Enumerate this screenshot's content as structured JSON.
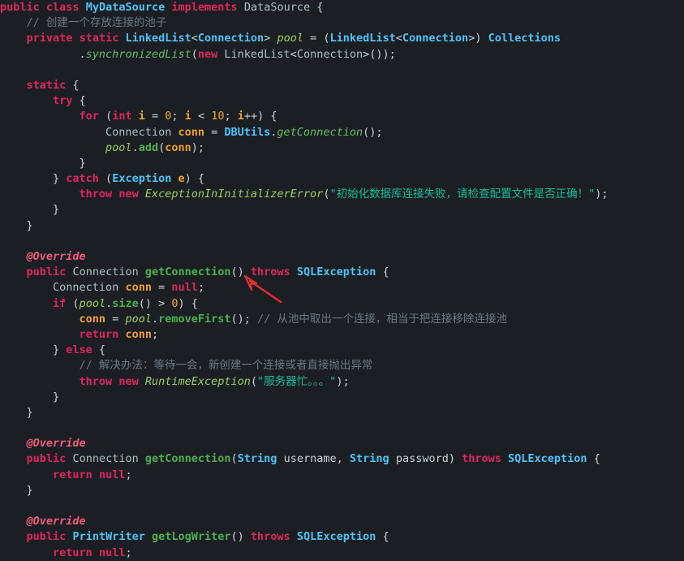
{
  "editor": {
    "language": "java",
    "background_color": "#1b1f23",
    "colors": {
      "keyword": "#e0245e",
      "class_name": "#4fc3f7",
      "method": "#4caf50",
      "string": "#1abc9c",
      "comment": "#6e7781",
      "number": "#f0a830",
      "variable": "#f0a030",
      "field": "#9ccc65",
      "annotation": "#ef5a7a",
      "punctuation": "#c9d1d9",
      "arrow_annotation": "#e03030"
    },
    "annotation": {
      "type": "red-arrow",
      "points_at": "getConnection",
      "color": "#e03030"
    }
  },
  "code": {
    "lines": [
      {
        "n": 1,
        "tokens": [
          {
            "t": "public",
            "c": "kw"
          },
          {
            "t": " ",
            "c": "punc"
          },
          {
            "t": "class",
            "c": "kw"
          },
          {
            "t": " ",
            "c": "punc"
          },
          {
            "t": "MyDataSource",
            "c": "type"
          },
          {
            "t": " ",
            "c": "punc"
          },
          {
            "t": "implements",
            "c": "kw"
          },
          {
            "t": " ",
            "c": "punc"
          },
          {
            "t": "DataSource",
            "c": "plaintype"
          },
          {
            "t": " {",
            "c": "punc"
          }
        ]
      },
      {
        "n": 2,
        "tokens": [
          {
            "t": "    ",
            "c": "punc"
          },
          {
            "t": "// 创建一个存放连接的池子",
            "c": "cmt"
          }
        ]
      },
      {
        "n": 3,
        "tokens": [
          {
            "t": "    ",
            "c": "punc"
          },
          {
            "t": "private",
            "c": "kw"
          },
          {
            "t": " ",
            "c": "punc"
          },
          {
            "t": "static",
            "c": "kw"
          },
          {
            "t": " ",
            "c": "punc"
          },
          {
            "t": "LinkedList",
            "c": "type"
          },
          {
            "t": "<",
            "c": "punc"
          },
          {
            "t": "Connection",
            "c": "type"
          },
          {
            "t": "> ",
            "c": "punc"
          },
          {
            "t": "pool",
            "c": "fld"
          },
          {
            "t": " = (",
            "c": "punc"
          },
          {
            "t": "LinkedList",
            "c": "type"
          },
          {
            "t": "<",
            "c": "punc"
          },
          {
            "t": "Connection",
            "c": "type"
          },
          {
            "t": ">) ",
            "c": "punc"
          },
          {
            "t": "Collections",
            "c": "type"
          }
        ]
      },
      {
        "n": 4,
        "tokens": [
          {
            "t": "            .",
            "c": "punc"
          },
          {
            "t": "synchronizedList",
            "c": "methi"
          },
          {
            "t": "(",
            "c": "punc"
          },
          {
            "t": "new",
            "c": "kw"
          },
          {
            "t": " ",
            "c": "punc"
          },
          {
            "t": "LinkedList",
            "c": "plaintype"
          },
          {
            "t": "<",
            "c": "punc"
          },
          {
            "t": "Connection",
            "c": "plaintype"
          },
          {
            "t": ">());",
            "c": "punc"
          }
        ]
      },
      {
        "n": 5,
        "tokens": []
      },
      {
        "n": 6,
        "tokens": [
          {
            "t": "    ",
            "c": "punc"
          },
          {
            "t": "static",
            "c": "kw"
          },
          {
            "t": " {",
            "c": "punc"
          }
        ]
      },
      {
        "n": 7,
        "tokens": [
          {
            "t": "        ",
            "c": "punc"
          },
          {
            "t": "try",
            "c": "kw"
          },
          {
            "t": " {",
            "c": "punc"
          }
        ]
      },
      {
        "n": 8,
        "tokens": [
          {
            "t": "            ",
            "c": "punc"
          },
          {
            "t": "for",
            "c": "kw"
          },
          {
            "t": " (",
            "c": "punc"
          },
          {
            "t": "int",
            "c": "kw"
          },
          {
            "t": " ",
            "c": "punc"
          },
          {
            "t": "i",
            "c": "var"
          },
          {
            "t": " = ",
            "c": "punc"
          },
          {
            "t": "0",
            "c": "num"
          },
          {
            "t": "; ",
            "c": "punc"
          },
          {
            "t": "i",
            "c": "var"
          },
          {
            "t": " < ",
            "c": "punc"
          },
          {
            "t": "10",
            "c": "num"
          },
          {
            "t": "; ",
            "c": "punc"
          },
          {
            "t": "i",
            "c": "var"
          },
          {
            "t": "++) {",
            "c": "punc"
          }
        ]
      },
      {
        "n": 9,
        "tokens": [
          {
            "t": "                ",
            "c": "punc"
          },
          {
            "t": "Connection",
            "c": "plaintype"
          },
          {
            "t": " ",
            "c": "punc"
          },
          {
            "t": "conn",
            "c": "var"
          },
          {
            "t": " = ",
            "c": "punc"
          },
          {
            "t": "DBUtils",
            "c": "type"
          },
          {
            "t": ".",
            "c": "punc"
          },
          {
            "t": "getConnection",
            "c": "methi"
          },
          {
            "t": "();",
            "c": "punc"
          }
        ]
      },
      {
        "n": 10,
        "tokens": [
          {
            "t": "                ",
            "c": "punc"
          },
          {
            "t": "pool",
            "c": "fld"
          },
          {
            "t": ".",
            "c": "punc"
          },
          {
            "t": "add",
            "c": "meth"
          },
          {
            "t": "(",
            "c": "punc"
          },
          {
            "t": "conn",
            "c": "var"
          },
          {
            "t": ");",
            "c": "punc"
          }
        ]
      },
      {
        "n": 11,
        "tokens": [
          {
            "t": "            }",
            "c": "punc"
          }
        ]
      },
      {
        "n": 12,
        "tokens": [
          {
            "t": "        } ",
            "c": "punc"
          },
          {
            "t": "catch",
            "c": "kw"
          },
          {
            "t": " (",
            "c": "punc"
          },
          {
            "t": "Exception",
            "c": "type"
          },
          {
            "t": " ",
            "c": "punc"
          },
          {
            "t": "e",
            "c": "var"
          },
          {
            "t": ") {",
            "c": "punc"
          }
        ]
      },
      {
        "n": 13,
        "tokens": [
          {
            "t": "            ",
            "c": "punc"
          },
          {
            "t": "throw",
            "c": "kw"
          },
          {
            "t": " ",
            "c": "punc"
          },
          {
            "t": "new",
            "c": "kw"
          },
          {
            "t": " ",
            "c": "punc"
          },
          {
            "t": "ExceptionInInitializerError",
            "c": "fld"
          },
          {
            "t": "(",
            "c": "punc"
          },
          {
            "t": "\"初始化数据库连接失败，请检查配置文件是否正确！\"",
            "c": "str"
          },
          {
            "t": ");",
            "c": "punc"
          }
        ]
      },
      {
        "n": 14,
        "tokens": [
          {
            "t": "        }",
            "c": "punc"
          }
        ]
      },
      {
        "n": 15,
        "tokens": [
          {
            "t": "    }",
            "c": "punc"
          }
        ]
      },
      {
        "n": 16,
        "tokens": []
      },
      {
        "n": 17,
        "tokens": [
          {
            "t": "    ",
            "c": "punc"
          },
          {
            "t": "@Override",
            "c": "ann"
          }
        ]
      },
      {
        "n": 18,
        "tokens": [
          {
            "t": "    ",
            "c": "punc"
          },
          {
            "t": "public",
            "c": "kw"
          },
          {
            "t": " ",
            "c": "punc"
          },
          {
            "t": "Connection",
            "c": "plaintype"
          },
          {
            "t": " ",
            "c": "punc"
          },
          {
            "t": "getConnection",
            "c": "meth"
          },
          {
            "t": "() ",
            "c": "punc"
          },
          {
            "t": "throws",
            "c": "kw"
          },
          {
            "t": " ",
            "c": "punc"
          },
          {
            "t": "SQLException",
            "c": "type"
          },
          {
            "t": " {",
            "c": "punc"
          }
        ]
      },
      {
        "n": 19,
        "tokens": [
          {
            "t": "        ",
            "c": "punc"
          },
          {
            "t": "Connection",
            "c": "plaintype"
          },
          {
            "t": " ",
            "c": "punc"
          },
          {
            "t": "conn",
            "c": "var"
          },
          {
            "t": " = ",
            "c": "punc"
          },
          {
            "t": "null",
            "c": "kw"
          },
          {
            "t": ";",
            "c": "punc"
          }
        ]
      },
      {
        "n": 20,
        "tokens": [
          {
            "t": "        ",
            "c": "punc"
          },
          {
            "t": "if",
            "c": "kw"
          },
          {
            "t": " (",
            "c": "punc"
          },
          {
            "t": "pool",
            "c": "fld"
          },
          {
            "t": ".",
            "c": "punc"
          },
          {
            "t": "size",
            "c": "meth"
          },
          {
            "t": "() > ",
            "c": "punc"
          },
          {
            "t": "0",
            "c": "num"
          },
          {
            "t": ") {",
            "c": "punc"
          }
        ]
      },
      {
        "n": 21,
        "tokens": [
          {
            "t": "            ",
            "c": "punc"
          },
          {
            "t": "conn",
            "c": "var"
          },
          {
            "t": " = ",
            "c": "punc"
          },
          {
            "t": "pool",
            "c": "fld"
          },
          {
            "t": ".",
            "c": "punc"
          },
          {
            "t": "removeFirst",
            "c": "meth"
          },
          {
            "t": "(); ",
            "c": "punc"
          },
          {
            "t": "// 从池中取出一个连接，相当于把连接移除连接池",
            "c": "cmt"
          }
        ]
      },
      {
        "n": 22,
        "tokens": [
          {
            "t": "            ",
            "c": "punc"
          },
          {
            "t": "return",
            "c": "kw"
          },
          {
            "t": " ",
            "c": "punc"
          },
          {
            "t": "conn",
            "c": "var"
          },
          {
            "t": ";",
            "c": "punc"
          }
        ]
      },
      {
        "n": 23,
        "tokens": [
          {
            "t": "        } ",
            "c": "punc"
          },
          {
            "t": "else",
            "c": "kw"
          },
          {
            "t": " {",
            "c": "punc"
          }
        ]
      },
      {
        "n": 24,
        "tokens": [
          {
            "t": "            ",
            "c": "punc"
          },
          {
            "t": "// 解决办法：等待一会，新创建一个连接或者直接抛出异常",
            "c": "cmt"
          }
        ]
      },
      {
        "n": 25,
        "tokens": [
          {
            "t": "            ",
            "c": "punc"
          },
          {
            "t": "throw",
            "c": "kw"
          },
          {
            "t": " ",
            "c": "punc"
          },
          {
            "t": "new",
            "c": "kw"
          },
          {
            "t": " ",
            "c": "punc"
          },
          {
            "t": "RuntimeException",
            "c": "fld"
          },
          {
            "t": "(",
            "c": "punc"
          },
          {
            "t": "\"服务器忙。。。\"",
            "c": "str"
          },
          {
            "t": ");",
            "c": "punc"
          }
        ]
      },
      {
        "n": 26,
        "tokens": [
          {
            "t": "        }",
            "c": "punc"
          }
        ]
      },
      {
        "n": 27,
        "tokens": [
          {
            "t": "    }",
            "c": "punc"
          }
        ]
      },
      {
        "n": 28,
        "tokens": []
      },
      {
        "n": 29,
        "tokens": [
          {
            "t": "    ",
            "c": "punc"
          },
          {
            "t": "@Override",
            "c": "ann"
          }
        ]
      },
      {
        "n": 30,
        "tokens": [
          {
            "t": "    ",
            "c": "punc"
          },
          {
            "t": "public",
            "c": "kw"
          },
          {
            "t": " ",
            "c": "punc"
          },
          {
            "t": "Connection",
            "c": "plaintype"
          },
          {
            "t": " ",
            "c": "punc"
          },
          {
            "t": "getConnection",
            "c": "meth"
          },
          {
            "t": "(",
            "c": "punc"
          },
          {
            "t": "String",
            "c": "type"
          },
          {
            "t": " ",
            "c": "punc"
          },
          {
            "t": "username",
            "c": "ident"
          },
          {
            "t": ", ",
            "c": "punc"
          },
          {
            "t": "String",
            "c": "type"
          },
          {
            "t": " ",
            "c": "punc"
          },
          {
            "t": "password",
            "c": "ident"
          },
          {
            "t": ") ",
            "c": "punc"
          },
          {
            "t": "throws",
            "c": "kw"
          },
          {
            "t": " ",
            "c": "punc"
          },
          {
            "t": "SQLException",
            "c": "type"
          },
          {
            "t": " {",
            "c": "punc"
          }
        ]
      },
      {
        "n": 31,
        "tokens": [
          {
            "t": "        ",
            "c": "punc"
          },
          {
            "t": "return",
            "c": "kw"
          },
          {
            "t": " ",
            "c": "punc"
          },
          {
            "t": "null",
            "c": "kw"
          },
          {
            "t": ";",
            "c": "punc"
          }
        ]
      },
      {
        "n": 32,
        "tokens": [
          {
            "t": "    }",
            "c": "punc"
          }
        ]
      },
      {
        "n": 33,
        "tokens": []
      },
      {
        "n": 34,
        "tokens": [
          {
            "t": "    ",
            "c": "punc"
          },
          {
            "t": "@Override",
            "c": "ann"
          }
        ]
      },
      {
        "n": 35,
        "tokens": [
          {
            "t": "    ",
            "c": "punc"
          },
          {
            "t": "public",
            "c": "kw"
          },
          {
            "t": " ",
            "c": "punc"
          },
          {
            "t": "PrintWriter",
            "c": "type"
          },
          {
            "t": " ",
            "c": "punc"
          },
          {
            "t": "getLogWriter",
            "c": "meth"
          },
          {
            "t": "() ",
            "c": "punc"
          },
          {
            "t": "throws",
            "c": "kw"
          },
          {
            "t": " ",
            "c": "punc"
          },
          {
            "t": "SQLException",
            "c": "type"
          },
          {
            "t": " {",
            "c": "punc"
          }
        ]
      },
      {
        "n": 36,
        "tokens": [
          {
            "t": "        ",
            "c": "punc"
          },
          {
            "t": "return",
            "c": "kw"
          },
          {
            "t": " ",
            "c": "punc"
          },
          {
            "t": "null",
            "c": "kw"
          },
          {
            "t": ";",
            "c": "punc"
          }
        ]
      }
    ]
  }
}
